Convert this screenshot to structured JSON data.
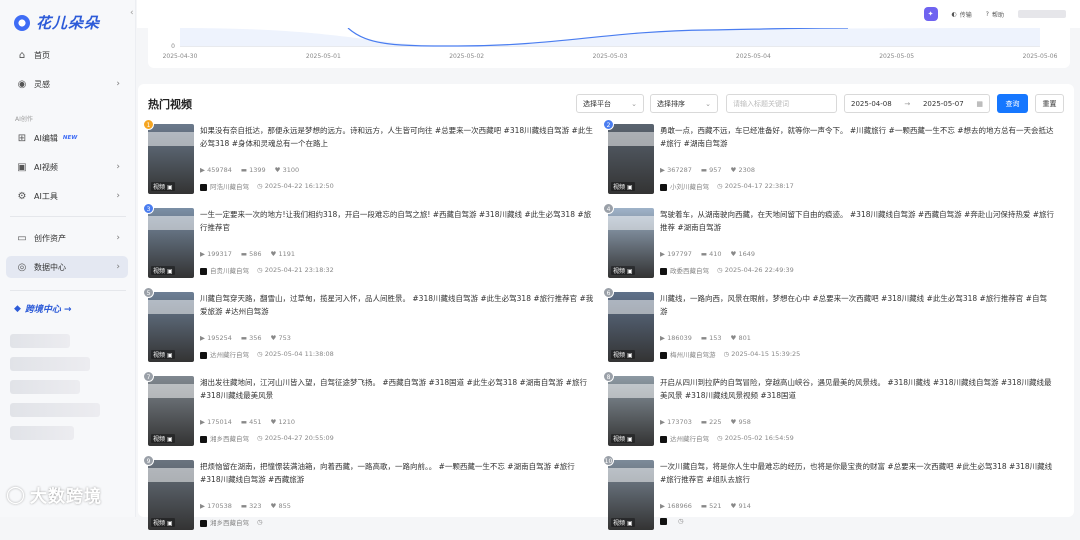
{
  "app": {
    "logo_text": "花儿朵朵"
  },
  "sidebar": {
    "items": [
      {
        "label": "首页",
        "icon": "home-icon"
      },
      {
        "label": "灵感",
        "icon": "location-pin-icon"
      },
      {
        "label": "AI编辑",
        "badge": "NEW",
        "icon": "ai-edit-icon"
      },
      {
        "label": "AI视频",
        "icon": "ai-video-icon"
      },
      {
        "label": "AI工具",
        "icon": "ai-tools-icon"
      },
      {
        "label": "创作资产",
        "icon": "folder-icon"
      },
      {
        "label": "数据中心",
        "icon": "data-center-icon"
      }
    ],
    "section_label": "AI创作",
    "trade_link": "跨境中心 →"
  },
  "watermark_text": "大数跨境",
  "topbar": {
    "transfer": "传输",
    "help": "帮助"
  },
  "chart_data": {
    "type": "line",
    "categories": [
      "2025-04-30",
      "2025-05-01",
      "2025-05-02",
      "2025-05-03",
      "2025-05-04",
      "2025-05-05",
      "2025-05-06"
    ],
    "y_tick_zero": "0"
  },
  "toolbar": {
    "title": "热门视频",
    "platform": "选择平台",
    "sort": "选择排序",
    "keyword_placeholder": "请输入标题关键词",
    "date_start": "2025-04-08",
    "date_end": "2025-05-07",
    "query": "查询",
    "reset": "重置"
  },
  "videos": [
    {
      "rank": "1",
      "desc": "如果没有奈自抵达，那便永远是梦想的远方。诗和远方，人生皆可向往 #总要来一次西藏吧 #318川藏线自驾游 #此生必驾318 #身体和灵魂总有一个在路上",
      "views": "459784",
      "comments": "1399",
      "likes": "3100",
      "author": "阿浩川藏自驾",
      "time": "2025-04-22 16:12:50",
      "rank_color": "#f5a623"
    },
    {
      "rank": "2",
      "desc": "勇敢一点，西藏不远，车已经准备好，就等你一声令下。 #川藏旅行 #一颗西藏一生不忘 #想去的地方总有一天会抵达 #旅行 #湖南自驾游",
      "views": "367287",
      "comments": "957",
      "likes": "2308",
      "author": "小刘川藏自驾",
      "time": "2025-04-17 22:38:17",
      "rank_color": "#4a7df0"
    },
    {
      "rank": "3",
      "desc": "一生一定要来一次的地方!让我们相约318，开启一段难忘的自驾之旅! #西藏自驾游 #318川藏线 #此生必驾318 #旅行推荐官",
      "views": "199317",
      "comments": "586",
      "likes": "1191",
      "author": "自贵川藏自驾",
      "time": "2025-04-21 23:18:32",
      "rank_color": "#4a7df0"
    },
    {
      "rank": "4",
      "desc": "驾驶着车，从湖南驶向西藏，在天地间留下自由的痕迹。 #318川藏线自驾游 #西藏自驾游 #奔赴山河保持热爱 #旅行推荐 #湖南自驾游",
      "views": "197797",
      "comments": "410",
      "likes": "1649",
      "author": "政委西藏自驾",
      "time": "2025-04-26 22:49:39",
      "rank_color": "#9aa0a8"
    },
    {
      "rank": "5",
      "desc": "川藏自驾穿天路，翻雪山，过草甸，揽星河入怀，品人间胜景。 #318川藏线自驾游 #此生必驾318 #旅行推荐官 #我爱旅游 #达州自驾游",
      "views": "195254",
      "comments": "356",
      "likes": "753",
      "author": "达州藏行自驾",
      "time": "2025-05-04 11:38:08",
      "rank_color": "#9aa0a8"
    },
    {
      "rank": "6",
      "desc": "川藏线，一路向西，风景在眼前，梦想在心中 #总要来一次西藏吧 #318川藏线 #此生必驾318 #旅行推荐官 #自驾游",
      "views": "186039",
      "comments": "153",
      "likes": "801",
      "author": "梅州川藏自驾游",
      "time": "2025-04-15 15:39:25",
      "rank_color": "#9aa0a8"
    },
    {
      "rank": "7",
      "desc": "湘出发往藏地间，江河山川皆入望，自驾征途梦飞扬。 #西藏自驾游 #318国道 #此生必驾318 #湖南自驾游 #旅行 #318川藏线最美风景",
      "views": "175014",
      "comments": "451",
      "likes": "1210",
      "author": "湘乡西藏自驾",
      "time": "2025-04-27 20:55:09",
      "rank_color": "#9aa0a8"
    },
    {
      "rank": "8",
      "desc": "开启从四川到拉萨的自驾冒险，穿越高山峡谷，遇见最美的风景线。 #318川藏线 #318川藏线自驾游 #318川藏线最美风景 #318川藏线风景视频 #318国道",
      "views": "173703",
      "comments": "225",
      "likes": "958",
      "author": "达州藏行自驾",
      "time": "2025-05-02 16:54:59",
      "rank_color": "#9aa0a8"
    },
    {
      "rank": "9",
      "desc": "把烦恼留在湖南，把憧憬装满油箱，向着西藏，一路高歌，一路向前。。 #一颗西藏一生不忘 #湖南自驾游 #旅行 #318川藏线自驾游 #西藏旅游",
      "views": "170538",
      "comments": "323",
      "likes": "855",
      "author": "湘乡西藏自驾",
      "time": "",
      "rank_color": "#9aa0a8"
    },
    {
      "rank": "10",
      "desc": "一次川藏自驾，将是你人生中最难忘的经历，也将是你最宝贵的财富 #总要来一次西藏吧 #此生必驾318 #318川藏线 #旅行推荐官 #组队去旅行",
      "views": "168966",
      "comments": "521",
      "likes": "914",
      "author": "",
      "time": "",
      "rank_color": "#9aa0a8"
    }
  ],
  "labels": {
    "video_tag": "视频"
  }
}
